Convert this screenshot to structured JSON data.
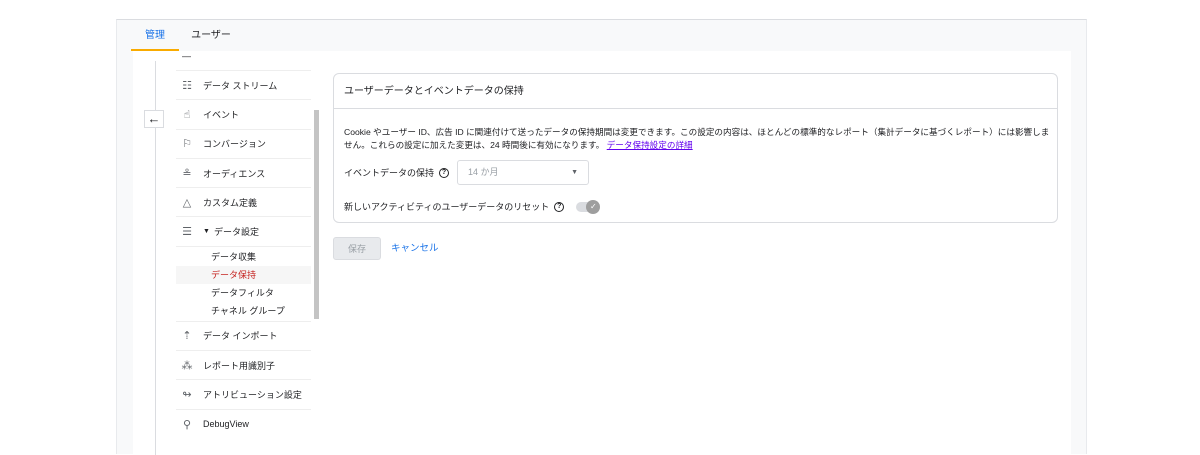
{
  "tabs": [
    {
      "label": "管理",
      "active": true
    },
    {
      "label": "ユーザー",
      "active": false
    }
  ],
  "nav": {
    "items_top": [
      {
        "label": "データ ストリーム",
        "icon": "data-stream-icon"
      },
      {
        "label": "イベント",
        "icon": "touch-icon"
      },
      {
        "label": "コンバージョン",
        "icon": "flag-icon"
      },
      {
        "label": "オーディエンス",
        "icon": "audience-icon"
      },
      {
        "label": "カスタム定義",
        "icon": "shapes-icon"
      },
      {
        "label": "データ設定",
        "icon": "database-icon"
      }
    ],
    "sub_items": [
      {
        "label": "データ収集",
        "active": false
      },
      {
        "label": "データ保持",
        "active": true
      },
      {
        "label": "データフィルタ",
        "active": false
      },
      {
        "label": "チャネル グループ",
        "active": false
      }
    ],
    "items_bottom": [
      {
        "label": "データ インポート",
        "icon": "upload-icon"
      },
      {
        "label": "レポート用識別子",
        "icon": "identifier-icon"
      },
      {
        "label": "アトリビューション設定",
        "icon": "attribution-icon"
      },
      {
        "label": "DebugView",
        "icon": "debug-icon"
      }
    ]
  },
  "card": {
    "title": "ユーザーデータとイベントデータの保持",
    "description": "Cookie やユーザー ID、広告 ID に関連付けて送ったデータの保持期間は変更できます。この設定の内容は、ほとんどの標準的なレポート（集計データに基づくレポート）には影響しません。これらの設定に加えた変更は、24 時間後に有効になります。",
    "link": "データ保持設定の詳細",
    "event_retention_label": "イベントデータの保持",
    "event_retention_value": "14 か月",
    "reset_label": "新しいアクティビティのユーザーデータのリセット",
    "reset_enabled": true
  },
  "buttons": {
    "save": "保存",
    "cancel": "キャンセル"
  }
}
